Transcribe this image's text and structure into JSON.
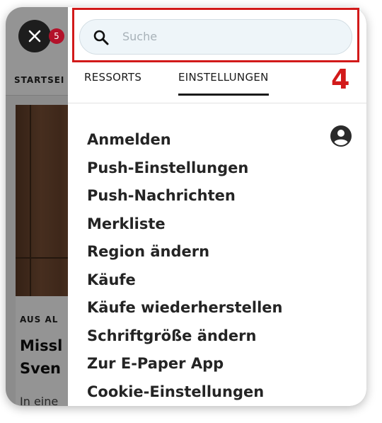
{
  "notification_count": "5",
  "background": {
    "nav_label": "STARTSEI",
    "kicker": "AUS AL",
    "headline_line1": "Missl",
    "headline_line2": "Sven",
    "teaser": "In eine"
  },
  "search": {
    "placeholder": "Suche"
  },
  "tabs": [
    {
      "label": "RESSORTS",
      "active": false
    },
    {
      "label": "EINSTELLUNGEN",
      "active": true
    }
  ],
  "menu": {
    "items": [
      {
        "label": "Anmelden"
      },
      {
        "label": "Push-Einstellungen"
      },
      {
        "label": "Push-Nachrichten"
      },
      {
        "label": "Merkliste"
      },
      {
        "label": "Region ändern"
      },
      {
        "label": "Käufe"
      },
      {
        "label": "Käufe wiederherstellen"
      },
      {
        "label": "Schriftgröße ändern"
      },
      {
        "label": "Zur E-Paper App"
      },
      {
        "label": "Cookie-Einstellungen"
      }
    ]
  },
  "annotation": {
    "step": "4",
    "color": "#d21a1a"
  },
  "colors": {
    "badge": "#b3122a",
    "search_bg": "#eef5f9"
  },
  "icons": {
    "close": "close-icon",
    "search": "search-icon",
    "account": "account-circle-icon"
  }
}
